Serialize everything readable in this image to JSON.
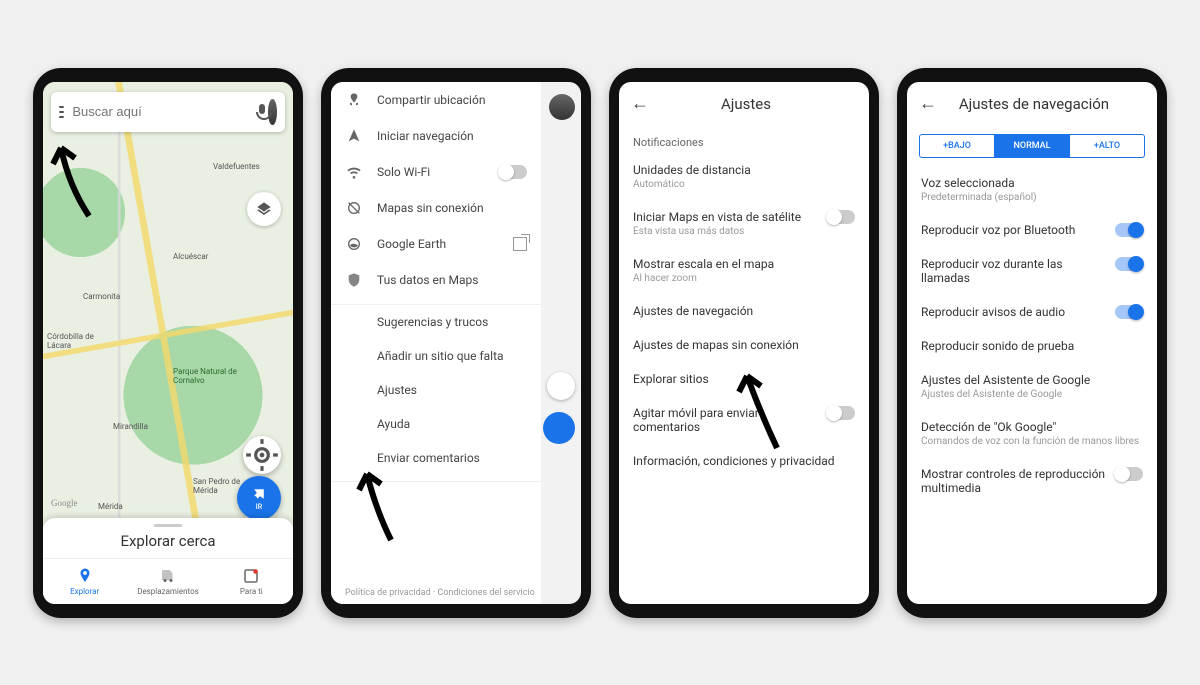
{
  "phone1": {
    "search_placeholder": "Buscar aquí",
    "layers_tip": "Capas",
    "explore_title": "Explorar cerca",
    "go_label": "IR",
    "nav": [
      {
        "label": "Explorar",
        "active": true
      },
      {
        "label": "Desplazamientos",
        "active": false
      },
      {
        "label": "Para ti",
        "active": false
      }
    ],
    "map_labels": [
      "Valdefuentes",
      "Alcuéscar",
      "Carmonita",
      "Córdobilla de Lácara",
      "Parque Natural de Cornalvo",
      "Mirandilla",
      "San Pedro de Mérida",
      "Mérida",
      "Google"
    ]
  },
  "phone2": {
    "items_with_icon": [
      "Compartir ubicación",
      "Iniciar navegación",
      "Solo Wi-Fi",
      "Mapas sin conexión",
      "Google Earth",
      "Tus datos en Maps"
    ],
    "items_noicon": [
      "Sugerencias y trucos",
      "Añadir un sitio que falta",
      "Ajustes",
      "Ayuda",
      "Enviar comentarios"
    ],
    "footer_privacy": "Política de privacidad",
    "footer_sep": " · ",
    "footer_terms": "Condiciones del servicio"
  },
  "phone3": {
    "title": "Ajustes",
    "section": "Notificaciones",
    "rows": [
      {
        "title": "Unidades de distancia",
        "sub": "Automático"
      },
      {
        "title": "Iniciar Maps en vista de satélite",
        "sub": "Esta vista usa más datos",
        "toggle": "off"
      },
      {
        "title": "Mostrar escala en el mapa",
        "sub": "Al hacer zoom"
      },
      {
        "title": "Ajustes de navegación"
      },
      {
        "title": "Ajustes de mapas sin conexión"
      },
      {
        "title": "Explorar sitios"
      },
      {
        "title": "Agitar móvil para enviar comentarios",
        "toggle": "off"
      },
      {
        "title": "Información, condiciones y privacidad"
      }
    ]
  },
  "phone4": {
    "title": "Ajustes de navegación",
    "seg": [
      "+BAJO",
      "NORMAL",
      "+ALTO"
    ],
    "seg_active": 1,
    "voice_label": "Voz seleccionada",
    "voice_sub": "Predeterminada (español)",
    "rows": [
      {
        "title": "Reproducir voz por Bluetooth",
        "toggle": "on"
      },
      {
        "title": "Reproducir voz durante las llamadas",
        "toggle": "on"
      },
      {
        "title": "Reproducir avisos de audio",
        "toggle": "on"
      },
      {
        "title": "Reproducir sonido de prueba"
      },
      {
        "title": "Ajustes del Asistente de Google",
        "sub": "Ajustes del Asistente de Google"
      },
      {
        "title": "Detección de \"Ok Google\"",
        "sub": "Comandos de voz con la función de manos libres"
      },
      {
        "title": "Mostrar controles de reproducción multimedia",
        "toggle": "off"
      }
    ]
  }
}
